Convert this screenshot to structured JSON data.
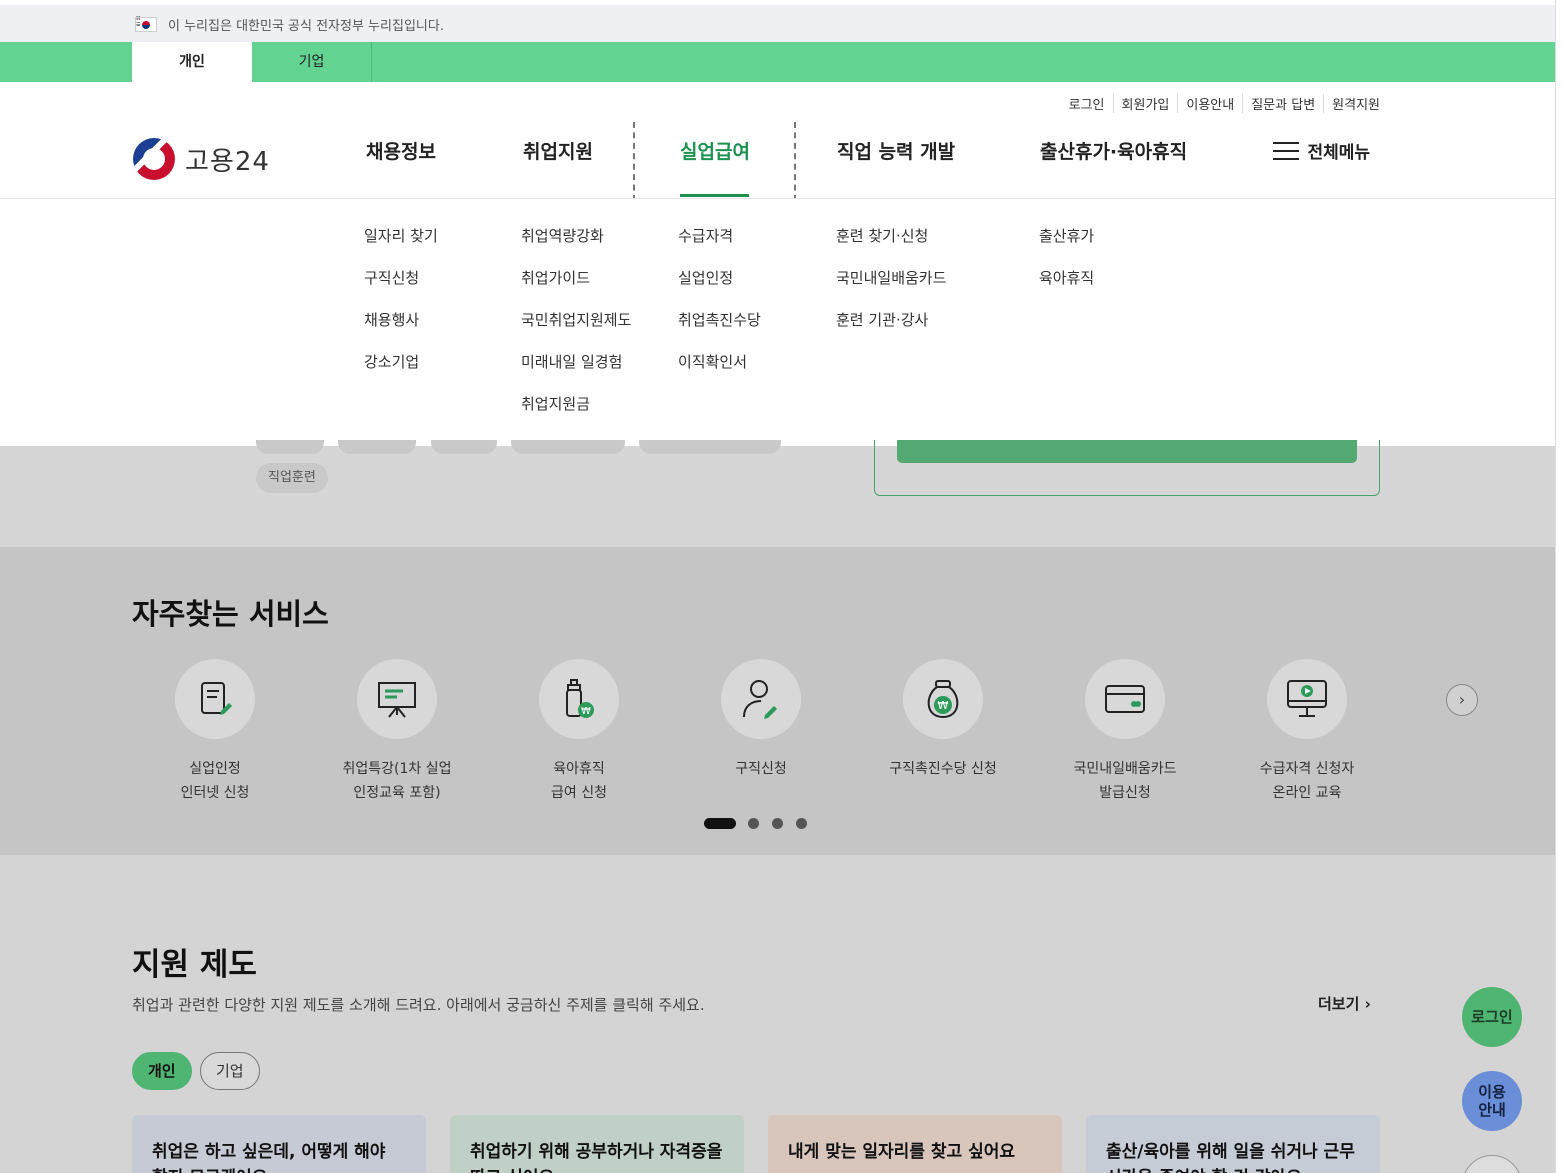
{
  "gov_banner": "이 누리집은 대한민국 공식 전자정부 누리집입니다.",
  "user_tabs": [
    "개인",
    "기업"
  ],
  "util_links": [
    "로그인",
    "회원가입",
    "이용안내",
    "질문과 답변",
    "원격지원"
  ],
  "logo_text": "고용24",
  "gnb": [
    "채용정보",
    "취업지원",
    "실업급여",
    "직업 능력 개발",
    "출산휴가·육아휴직"
  ],
  "all_menu": "전체메뉴",
  "dropdown": {
    "col1": [
      "일자리 찾기",
      "구직신청",
      "채용행사",
      "강소기업"
    ],
    "col2": [
      "취업역량강화",
      "취업가이드",
      "국민취업지원제도",
      "미래내일 일경험",
      "취업지원금"
    ],
    "col3": [
      "수급자격",
      "실업인정",
      "취업촉진수당",
      "이직확인서"
    ],
    "col4": [
      "훈련 찾기·신청",
      "국민내일배움카드",
      "훈련 기관·강사"
    ],
    "col5": [
      "출산휴가",
      "육아휴직"
    ]
  },
  "chip": "직업훈련",
  "services": {
    "title": "자주찾는 서비스",
    "items": [
      {
        "label": "실업인정\n인터넷 신청",
        "icon": "document-pen-icon"
      },
      {
        "label": "취업특강(1차 실업\n인정교육 포함)",
        "icon": "presentation-board-icon"
      },
      {
        "label": "육아휴직\n급여 신청",
        "icon": "baby-bottle-won-icon"
      },
      {
        "label": "구직신청",
        "icon": "person-pen-icon"
      },
      {
        "label": "구직촉진수당 신청",
        "icon": "money-bag-won-icon"
      },
      {
        "label": "국민내일배움카드\n발급신청",
        "icon": "card-icon"
      },
      {
        "label": "수급자격 신청자\n온라인 교육",
        "icon": "monitor-play-icon"
      }
    ]
  },
  "support": {
    "title": "지원 제도",
    "desc": "취업과 관련한 다양한 지원 제도를 소개해 드려요. 아래에서 궁금하신 주제를 클릭해 주세요.",
    "more": "더보기",
    "tabs": [
      "개인",
      "기업"
    ],
    "cards": [
      {
        "text": "취업은 하고 싶은데, 어떻게 해야 할지 모르겠어요",
        "color": "#c5cad4"
      },
      {
        "text": "취업하기 위해 공부하거나 자격증을 따고 싶어요",
        "color": "#c1d0c7"
      },
      {
        "text": "내게 맞는 일자리를 찾고 싶어요",
        "color": "#d8c6bd"
      },
      {
        "text": "출산/육아를 위해 일을 쉬거나 근무 시간을 줄여야 할 것 같아요",
        "color": "#c6ccd6"
      }
    ]
  },
  "floating": {
    "login": "로그인",
    "guide": "이용\n안내"
  },
  "colors": {
    "brand_green": "#62d391",
    "active_green": "#1d9150"
  }
}
